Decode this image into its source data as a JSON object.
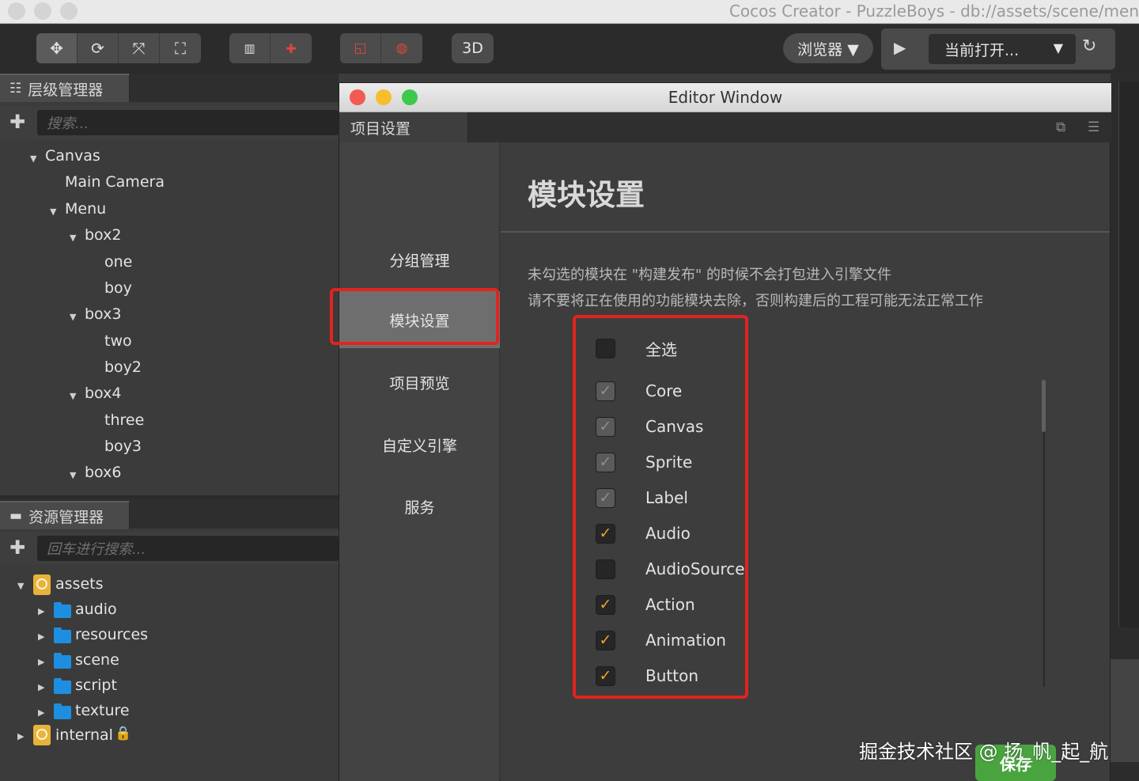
{
  "app_title": "Cocos Creator - PuzzleBoys - db://assets/scene/men",
  "toolbar": {
    "browser_label": "浏览器 ▼",
    "btn_3d": "3D",
    "current_open": "当前打开...",
    "current_open_arrow": "▼"
  },
  "hierarchy": {
    "title": "层级管理器",
    "search_placeholder": "搜索...",
    "nodes": {
      "canvas": "Canvas",
      "main_camera": "Main Camera",
      "menu": "Menu",
      "box2": "box2",
      "one": "one",
      "boy": "boy",
      "box3": "box3",
      "two": "two",
      "boy2": "boy2",
      "box4": "box4",
      "three": "three",
      "boy3": "boy3",
      "box6": "box6"
    }
  },
  "assets": {
    "title": "资源管理器",
    "search_placeholder": "回车进行搜索...",
    "nodes": {
      "assets": "assets",
      "audio": "audio",
      "resources": "resources",
      "scene": "scene",
      "script": "script",
      "texture": "texture",
      "internal": "internal"
    }
  },
  "editor_window": {
    "title": "Editor Window",
    "tab": "项目设置",
    "sidebar": [
      "分组管理",
      "模块设置",
      "项目预览",
      "自定义引擎",
      "服务"
    ],
    "heading": "模块设置",
    "desc1": "未勾选的模块在 \"构建发布\" 的时候不会打包进入引擎文件",
    "desc2": "请不要将正在使用的功能模块去除，否则构建后的工程可能无法正常工作",
    "modules": {
      "select_all": "全选",
      "core": "Core",
      "canvas": "Canvas",
      "sprite": "Sprite",
      "label": "Label",
      "audio": "Audio",
      "audiosource": "AudioSource",
      "action": "Action",
      "animation": "Animation",
      "button": "Button"
    },
    "save": "保存"
  },
  "watermark": "掘金技术社区 @ 扬_帆_起_航",
  "colors": {
    "highlight": "#e3231e",
    "check": "#f0a12a",
    "save_green": "#49a43f",
    "folder_blue": "#1e8fe0"
  }
}
